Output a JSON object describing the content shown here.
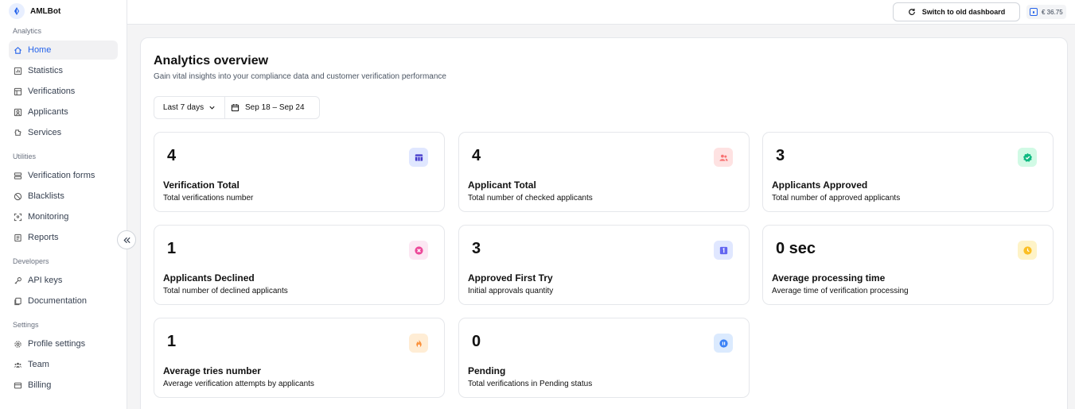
{
  "brand": {
    "name": "AMLBot"
  },
  "sidebar": {
    "sections": [
      {
        "label": "Analytics",
        "items": [
          {
            "label": "Home",
            "icon": "home-icon",
            "active": true
          },
          {
            "label": "Statistics",
            "icon": "statistics-icon"
          },
          {
            "label": "Verifications",
            "icon": "verifications-icon"
          },
          {
            "label": "Applicants",
            "icon": "applicants-icon"
          },
          {
            "label": "Services",
            "icon": "services-icon"
          }
        ]
      },
      {
        "label": "Utilities",
        "items": [
          {
            "label": "Verification forms",
            "icon": "forms-icon"
          },
          {
            "label": "Blacklists",
            "icon": "blacklist-icon"
          },
          {
            "label": "Monitoring",
            "icon": "monitoring-icon"
          },
          {
            "label": "Reports",
            "icon": "reports-icon"
          }
        ]
      },
      {
        "label": "Developers",
        "items": [
          {
            "label": "API keys",
            "icon": "key-icon"
          },
          {
            "label": "Documentation",
            "icon": "docs-icon"
          }
        ]
      },
      {
        "label": "Settings",
        "items": [
          {
            "label": "Profile settings",
            "icon": "gear-icon"
          },
          {
            "label": "Team",
            "icon": "team-icon"
          },
          {
            "label": "Billing",
            "icon": "billing-icon"
          }
        ]
      }
    ]
  },
  "topbar": {
    "switch_label": "Switch to old dashboard",
    "balance": "€ 36.75"
  },
  "main": {
    "title": "Analytics overview",
    "subtitle": "Gain vital insights into your compliance data and customer verification performance",
    "filter": {
      "range": "Last 7 days",
      "dates": "Sep 18 – Sep 24"
    },
    "cards": [
      {
        "value": "4",
        "label": "Verification Total",
        "desc": "Total verifications number",
        "icon": "table-icon",
        "bg": "#e0e7ff",
        "fg": "#4338ca"
      },
      {
        "value": "4",
        "label": "Applicant Total",
        "desc": "Total number of checked applicants",
        "icon": "users-icon",
        "bg": "#fee2e2",
        "fg": "#f87171"
      },
      {
        "value": "3",
        "label": "Applicants Approved",
        "desc": "Total number of approved applicants",
        "icon": "check-badge-icon",
        "bg": "#d1fae5",
        "fg": "#10b981"
      },
      {
        "value": "1",
        "label": "Applicants Declined",
        "desc": "Total number of declined applicants",
        "icon": "x-circle-icon",
        "bg": "#fce7f3",
        "fg": "#ec4899"
      },
      {
        "value": "3",
        "label": "Approved First Try",
        "desc": "Initial approvals quantity",
        "icon": "number-one-icon",
        "bg": "#e0e7ff",
        "fg": "#6366f1"
      },
      {
        "value": "0 sec",
        "label": "Average processing time",
        "desc": "Average time of verification processing",
        "icon": "clock-icon",
        "bg": "#fef3c7",
        "fg": "#fbbf24"
      },
      {
        "value": "1",
        "label": "Average tries number",
        "desc": "Average verification attempts by applicants",
        "icon": "flame-icon",
        "bg": "#ffedd5",
        "fg": "#fb923c"
      },
      {
        "value": "0",
        "label": "Pending",
        "desc": "Total verifications in Pending status",
        "icon": "pause-circle-icon",
        "bg": "#dbeafe",
        "fg": "#3b82f6"
      }
    ]
  }
}
